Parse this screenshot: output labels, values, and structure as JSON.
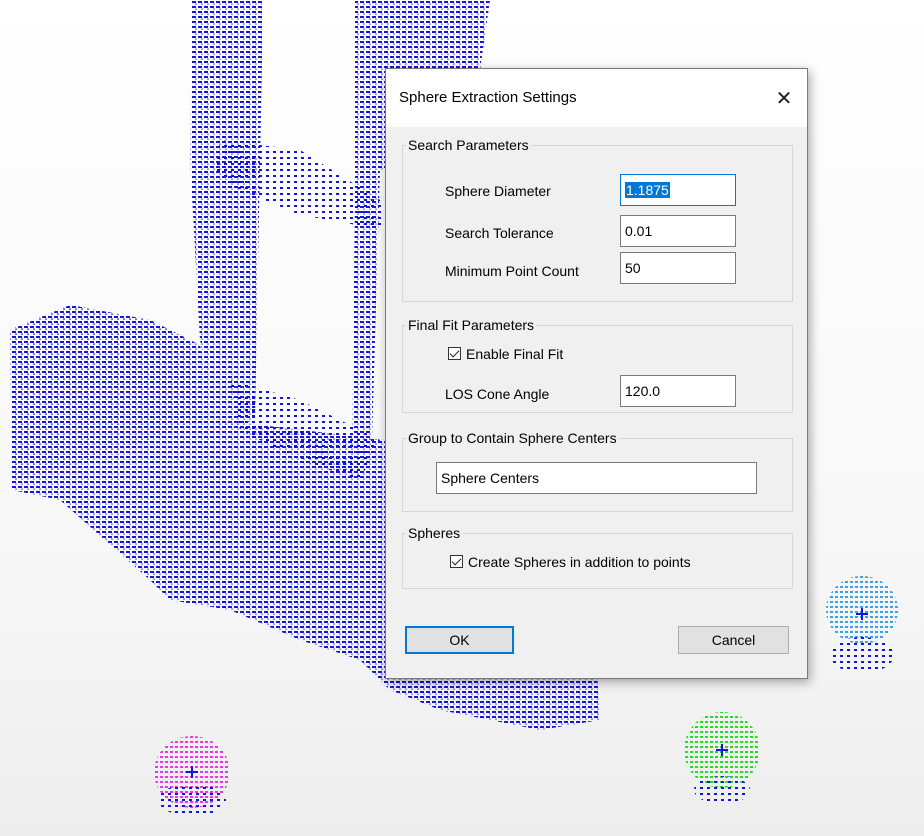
{
  "dialog": {
    "title": "Sphere Extraction Settings",
    "close_glyph": "✕",
    "search_params": {
      "legend": "Search Parameters",
      "sphere_diameter_label": "Sphere Diameter",
      "sphere_diameter_value": "1.1875",
      "search_tolerance_label": "Search Tolerance",
      "search_tolerance_value": "0.01",
      "min_point_count_label": "Minimum Point Count",
      "min_point_count_value": "50"
    },
    "final_fit": {
      "legend": "Final Fit Parameters",
      "enable_label": "Enable Final Fit",
      "enable_checked": true,
      "los_cone_label": "LOS Cone Angle",
      "los_cone_value": "120.0"
    },
    "group": {
      "legend": "Group to Contain Sphere Centers",
      "value": "Sphere Centers"
    },
    "spheres": {
      "legend": "Spheres",
      "create_label": "Create Spheres in addition to points",
      "create_checked": true
    },
    "ok_label": "OK",
    "cancel_label": "Cancel"
  },
  "scene": {
    "pointcloud_color": "#1515d8",
    "target_colors": [
      "#3aa0e8",
      "#22dd22",
      "#ee33ee"
    ]
  }
}
